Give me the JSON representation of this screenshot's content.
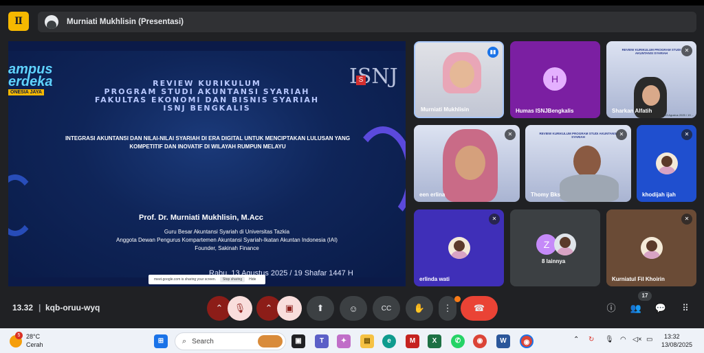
{
  "header": {
    "app_icon": "meet-app-icon",
    "presenter_name": "Murniati Mukhlisin (Presentasi)"
  },
  "slide": {
    "kampus_title": "ampus\nerdeka",
    "kampus_sub": "ONESIA JAYA",
    "logo_text": "ISNJ",
    "logo_badge": "S",
    "title_lines": [
      "REVIEW KURIKULUM",
      "PROGRAM STUDI AKUNTANSI SYARIAH",
      "FAKULTAS EKONOMI DAN BISNIS SYARIAH",
      "ISNJ BENGKALIS"
    ],
    "subtitle": "INTEGRASI AKUNTANSI DAN NILAI-NILAI SYARIAH DI ERA DIGITAL UNTUK MENCIPTAKAN LULUSAN YANG KOMPETITIF DAN INOVATIF DI WILAYAH RUMPUN MELAYU",
    "speaker": "Prof. Dr. Murniati Mukhlisin, M.Acc",
    "roles": [
      "Guru Besar Akuntansi Syariah di Universitas Tazkia",
      "Anggota Dewan Pengurus Kompartemen Akuntansi Syariah-Ikatan Akuntan Indonesia (IAI)",
      "Founder, Sakinah Finance"
    ],
    "date": "Rabu, 13 Agustus 2025 / 19 Shafar 1447 H"
  },
  "share_bar": {
    "message": "meet.google.com is sharing your screen.",
    "stop_label": "Stop sharing",
    "hide_label": "Hide"
  },
  "tiles": [
    {
      "name": "Murniati Mukhlisin",
      "letter": ""
    },
    {
      "name": "Humas ISNJBengkalis",
      "letter": "H"
    },
    {
      "name": "Sharkan Alfatih",
      "letter": ""
    },
    {
      "name": "een erlina",
      "letter": ""
    },
    {
      "name": "Thomy Bks",
      "letter": ""
    },
    {
      "name": "khodijah ijah",
      "letter": ""
    },
    {
      "name": "erlinda wati",
      "letter": ""
    },
    {
      "name": "8 lainnya",
      "letter": "Z"
    },
    {
      "name": "Kurniatul Fil Khoirin",
      "letter": ""
    }
  ],
  "tile_timestamp": "13 Agustus 2025 / 19 ...",
  "meet_bar": {
    "time": "13.32",
    "meeting_code": "kqb-oruu-wyq",
    "participants_count": "17"
  },
  "icons": {
    "chevron": "⌃",
    "mic_off": "🎙",
    "cam_off": "▣",
    "present": "⬆",
    "emoji": "☺",
    "captions": "CC",
    "raise_hand": "✋",
    "more": "⋮",
    "end_call": "☎",
    "info": "ⓘ",
    "people": "👥",
    "chat": "💬",
    "apps": "⠿"
  },
  "taskbar": {
    "weather_temp": "28°C",
    "weather_text": "Cerah",
    "weather_badge": "5",
    "search_label": "Search",
    "time": "13:32",
    "date": "13/08/2025"
  }
}
